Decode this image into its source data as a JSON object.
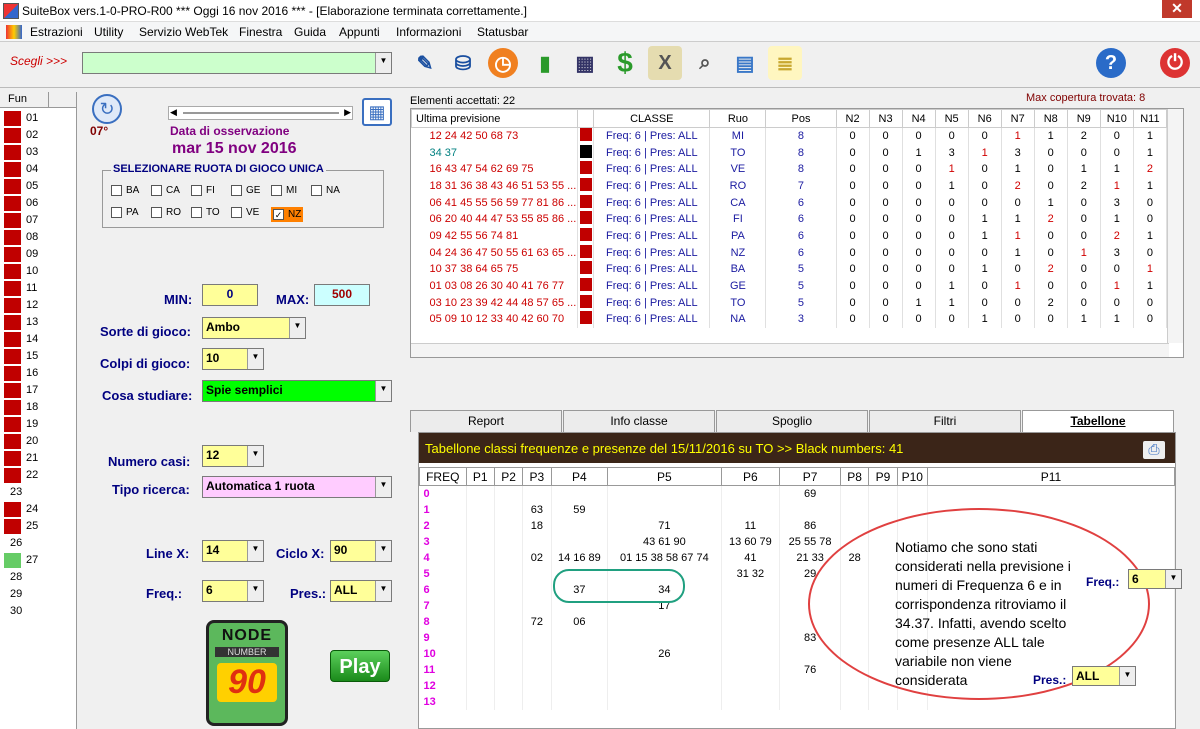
{
  "title": "SuiteBox vers.1-0-PRO-R00  ***  Oggi 16 nov 2016  ***  - [Elaborazione terminata correttamente.]",
  "menu": [
    "Estrazioni",
    "Utility",
    "Servizio WebTek",
    "Finestra",
    "Guida",
    "Appunti",
    "Informazioni",
    "Statusbar"
  ],
  "scegli_label": "Scegli >>>",
  "fun_header": "Fun",
  "fun_rows": [
    {
      "n": "01",
      "c": "#c00000"
    },
    {
      "n": "02",
      "c": "#c00000"
    },
    {
      "n": "03",
      "c": "#c00000"
    },
    {
      "n": "04",
      "c": "#c00000"
    },
    {
      "n": "05",
      "c": "#c00000"
    },
    {
      "n": "06",
      "c": "#c00000"
    },
    {
      "n": "07",
      "c": "#c00000"
    },
    {
      "n": "08",
      "c": "#c00000"
    },
    {
      "n": "09",
      "c": "#c00000"
    },
    {
      "n": "10",
      "c": "#c00000"
    },
    {
      "n": "11",
      "c": "#c00000"
    },
    {
      "n": "12",
      "c": "#c00000"
    },
    {
      "n": "13",
      "c": "#c00000"
    },
    {
      "n": "14",
      "c": "#c00000"
    },
    {
      "n": "15",
      "c": "#c00000"
    },
    {
      "n": "16",
      "c": "#c00000"
    },
    {
      "n": "17",
      "c": "#c00000"
    },
    {
      "n": "18",
      "c": "#c00000"
    },
    {
      "n": "19",
      "c": "#c00000"
    },
    {
      "n": "20",
      "c": "#c00000"
    },
    {
      "n": "21",
      "c": "#c00000"
    },
    {
      "n": "22",
      "c": "#c00000"
    },
    {
      "n": "23",
      "c": ""
    },
    {
      "n": "24",
      "c": "#c00000"
    },
    {
      "n": "25",
      "c": "#c00000"
    },
    {
      "n": "26",
      "c": ""
    },
    {
      "n": "27",
      "c": "#66cc66"
    },
    {
      "n": "28",
      "c": ""
    },
    {
      "n": "29",
      "c": ""
    },
    {
      "n": "30",
      "c": ""
    }
  ],
  "left": {
    "deg": "07°",
    "data_label": "Data di osservazione",
    "date": "mar 15 nov 2016",
    "ruota_title": "SELEZIONARE RUOTA DI GIOCO UNICA",
    "ruote_row1": [
      "BA",
      "CA",
      "FI",
      "GE",
      "MI",
      "NA"
    ],
    "ruote_row2": [
      "PA",
      "RO",
      "TO",
      "VE",
      "NZ"
    ],
    "min_label": "MIN:",
    "min_val": "0",
    "max_label": "MAX:",
    "max_val": "500",
    "sorte_label": "Sorte di gioco:",
    "sorte_val": "Ambo",
    "colpi_label": "Colpi di gioco:",
    "colpi_val": "10",
    "cosa_label": "Cosa studiare:",
    "cosa_val": "Spie semplici",
    "casi_label": "Numero casi:",
    "casi_val": "12",
    "tipo_label": "Tipo ricerca:",
    "tipo_val": "Automatica 1 ruota",
    "linex_label": "Line X:",
    "linex_val": "14",
    "ciclo_label": "Ciclo X:",
    "ciclo_val": "90",
    "freq_label": "Freq.:",
    "freq_val": "6",
    "pres_label": "Pres.:",
    "pres_val": "ALL",
    "logo_top": "NODE",
    "logo_mid": "NUMBER",
    "logo_num": "90",
    "play": "Play"
  },
  "elementi": "Elementi accettati: 22",
  "max_cop": "Max copertura trovata:   8",
  "pred_headers": [
    "Ultima previsione",
    "",
    "CLASSE",
    "Ruo",
    "Pos",
    "N2",
    "N3",
    "N4",
    "N5",
    "N6",
    "N7",
    "N8",
    "N9",
    "N10",
    "N11"
  ],
  "pred_rows": [
    [
      "12 24 42 50 68 73",
      "Freq: 6 | Pres: ALL",
      "MI",
      "8",
      "0",
      "0",
      "0",
      "0",
      "0",
      "1",
      "1",
      "2",
      "0",
      "1"
    ],
    [
      "34 37",
      "Freq: 6 | Pres: ALL",
      "TO",
      "8",
      "0",
      "0",
      "1",
      "3",
      "1",
      "3",
      "0",
      "0",
      "0",
      "1"
    ],
    [
      "16 43 47 54 62 69 75",
      "Freq: 6 | Pres: ALL",
      "VE",
      "8",
      "0",
      "0",
      "0",
      "1",
      "0",
      "1",
      "0",
      "1",
      "1",
      "2"
    ],
    [
      "18 31 36 38 43 46 51 53 55 ...",
      "Freq: 6 | Pres: ALL",
      "RO",
      "7",
      "0",
      "0",
      "0",
      "1",
      "0",
      "2",
      "0",
      "2",
      "1",
      "1"
    ],
    [
      "06 41 45 55 56 59 77 81 86 ...",
      "Freq: 6 | Pres: ALL",
      "CA",
      "6",
      "0",
      "0",
      "0",
      "0",
      "0",
      "0",
      "1",
      "0",
      "3",
      "0"
    ],
    [
      "06 20 40 44 47 53 55 85 86 ...",
      "Freq: 6 | Pres: ALL",
      "FI",
      "6",
      "0",
      "0",
      "0",
      "0",
      "1",
      "1",
      "2",
      "0",
      "1",
      "0"
    ],
    [
      "09 42 55 56 74 81",
      "Freq: 6 | Pres: ALL",
      "PA",
      "6",
      "0",
      "0",
      "0",
      "0",
      "1",
      "1",
      "0",
      "0",
      "2",
      "1"
    ],
    [
      "04 24 36 47 50 55 61 63 65 ...",
      "Freq: 6 | Pres: ALL",
      "NZ",
      "6",
      "0",
      "0",
      "0",
      "0",
      "0",
      "1",
      "0",
      "1",
      "3",
      "0"
    ],
    [
      "10 37 38 64 65 75",
      "Freq: 6 | Pres: ALL",
      "BA",
      "5",
      "0",
      "0",
      "0",
      "0",
      "1",
      "0",
      "2",
      "0",
      "0",
      "1"
    ],
    [
      "01 03 08 26 30 40 41 76 77",
      "Freq: 6 | Pres: ALL",
      "GE",
      "5",
      "0",
      "0",
      "0",
      "1",
      "0",
      "1",
      "0",
      "0",
      "1",
      "1"
    ],
    [
      "03 10 23 39 42 44 48 57 65 ...",
      "Freq: 6 | Pres: ALL",
      "TO",
      "5",
      "0",
      "0",
      "1",
      "1",
      "0",
      "0",
      "2",
      "0",
      "0",
      "0"
    ],
    [
      "05 09 10 12 33 40 42 60 70",
      "Freq: 6 | Pres: ALL",
      "NA",
      "3",
      "0",
      "0",
      "0",
      "0",
      "1",
      "0",
      "0",
      "1",
      "1",
      "0"
    ]
  ],
  "tabs": [
    "Report",
    "Info classe",
    "Spoglio",
    "Filtri",
    "Tabellone"
  ],
  "tab_header": "Tabellone classi frequenze e presenze del 15/11/2016 su TO >> Black numbers: 41",
  "freq_headers": [
    "FREQ",
    "P1",
    "P2",
    "P3",
    "P4",
    "P5",
    "P6",
    "P7",
    "P8",
    "P9",
    "P10",
    "P11"
  ],
  "freq_rows": [
    [
      "0",
      "",
      "",
      "",
      "",
      "",
      "",
      "69",
      "",
      "",
      "",
      ""
    ],
    [
      "1",
      "",
      "",
      "63",
      "59",
      "",
      "",
      "",
      "",
      "",
      "",
      ""
    ],
    [
      "2",
      "",
      "",
      "18",
      "",
      "71",
      "11",
      "86",
      "",
      "",
      "",
      ""
    ],
    [
      "3",
      "",
      "",
      "",
      "",
      "43 61 90",
      "13 60 79",
      "25 55 78",
      "",
      "",
      "",
      ""
    ],
    [
      "4",
      "",
      "",
      "02",
      "14 16 89",
      "01 15 38 58 67 74",
      "41",
      "21 33",
      "28",
      "",
      "",
      ""
    ],
    [
      "5",
      "",
      "",
      "",
      "",
      "",
      "31 32",
      "29",
      "",
      "",
      "",
      ""
    ],
    [
      "6",
      "",
      "",
      "",
      "37",
      "34",
      "",
      "",
      "",
      "",
      "",
      ""
    ],
    [
      "7",
      "",
      "",
      "",
      "",
      "17",
      "",
      "",
      "",
      "",
      "",
      ""
    ],
    [
      "8",
      "",
      "",
      "72",
      "06",
      "",
      "",
      "",
      "",
      "",
      "",
      ""
    ],
    [
      "9",
      "",
      "",
      "",
      "",
      "",
      "",
      "83",
      "",
      "",
      "",
      ""
    ],
    [
      "10",
      "",
      "",
      "",
      "",
      "26",
      "",
      "",
      "",
      "",
      "",
      ""
    ],
    [
      "11",
      "",
      "",
      "",
      "",
      "",
      "",
      "76",
      "",
      "",
      "",
      ""
    ],
    [
      "12",
      "",
      "",
      "",
      "",
      "",
      "",
      "",
      "",
      "",
      "",
      ""
    ],
    [
      "13",
      "",
      "",
      "",
      "",
      "",
      "",
      "",
      "",
      "",
      "",
      ""
    ]
  ],
  "note": "Notiamo che sono stati considerati nella previsione i numeri di Frequenza 6 e in corrispondenza ritroviamo il 34.37. Infatti, avendo scelto come presenze ALL tale variabile non viene considerata",
  "note_freq_label": "Freq.:",
  "note_freq_val": "6",
  "note_pres_label": "Pres.:",
  "note_pres_val": "ALL"
}
